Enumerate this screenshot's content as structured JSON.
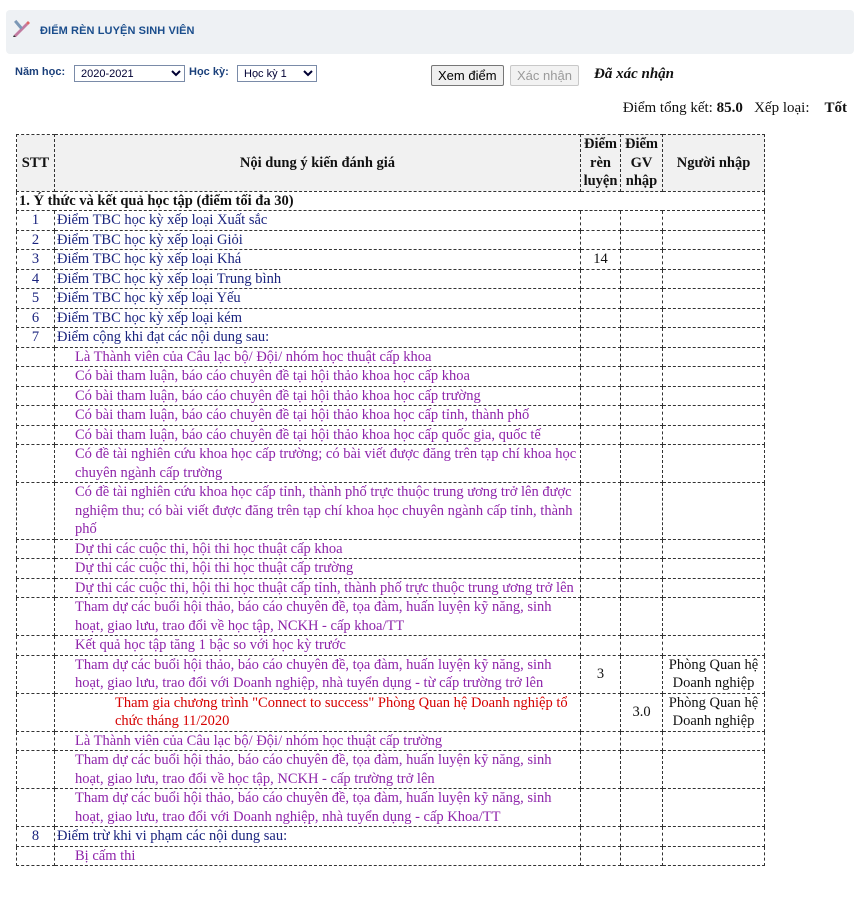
{
  "header": {
    "title": "ĐIỂM RÈN LUYỆN SINH VIÊN",
    "icon": "pencil-ruler-icon"
  },
  "filters": {
    "year_label": "Năm học:",
    "year_value": "2020-2021",
    "term_label": "Học kỳ:",
    "term_value": "Học kỳ 1",
    "view_button": "Xem điểm",
    "confirm_button": "Xác nhận",
    "status": "Đã xác nhận"
  },
  "summary": {
    "total_label": "Điểm tổng kết:",
    "total_value": "85.0",
    "rank_label": "Xếp loại:",
    "rank_value": "Tốt"
  },
  "table": {
    "headers": {
      "stt": "STT",
      "content": "Nội dung ý kiến đánh giá",
      "score": "Điểm rèn luyện",
      "gv_score": "Điểm GV nhập",
      "entered_by": "Người nhập"
    },
    "section1": "1. Ý thức và kết quả học tập (điểm tối đa 30)",
    "rows": [
      {
        "stt": "1",
        "text": "Điểm TBC học kỳ xếp loại Xuất sắc",
        "level": "main",
        "score": "",
        "gv": "",
        "who": ""
      },
      {
        "stt": "2",
        "text": "Điểm TBC học kỳ xếp loại Giỏi",
        "level": "main",
        "score": "",
        "gv": "",
        "who": ""
      },
      {
        "stt": "3",
        "text": "Điểm TBC học kỳ xếp loại Khá",
        "level": "main",
        "score": "14",
        "gv": "",
        "who": ""
      },
      {
        "stt": "4",
        "text": "Điểm TBC học kỳ xếp loại Trung bình",
        "level": "main",
        "score": "",
        "gv": "",
        "who": ""
      },
      {
        "stt": "5",
        "text": "Điểm TBC học kỳ xếp loại Yếu",
        "level": "main",
        "score": "",
        "gv": "",
        "who": ""
      },
      {
        "stt": "6",
        "text": "Điểm TBC học kỳ xếp loại kém",
        "level": "main",
        "score": "",
        "gv": "",
        "who": ""
      },
      {
        "stt": "7",
        "text": "Điểm cộng khi đạt các nội dung sau:",
        "level": "main",
        "score": "",
        "gv": "",
        "who": ""
      },
      {
        "stt": "",
        "text": "Là Thành viên của Câu lạc bộ/ Đội/ nhóm học thuật cấp khoa",
        "level": "sub",
        "score": "",
        "gv": "",
        "who": ""
      },
      {
        "stt": "",
        "text": "Có bài tham luận, báo cáo chuyên đề tại hội thảo khoa học cấp khoa",
        "level": "sub",
        "score": "",
        "gv": "",
        "who": ""
      },
      {
        "stt": "",
        "text": "Có bài tham luận, báo cáo chuyên đề tại hội thảo khoa học cấp trường",
        "level": "sub",
        "score": "",
        "gv": "",
        "who": ""
      },
      {
        "stt": "",
        "text": "Có bài tham luận, báo cáo chuyên đề tại hội thảo khoa học cấp tỉnh, thành phố",
        "level": "sub",
        "score": "",
        "gv": "",
        "who": ""
      },
      {
        "stt": "",
        "text": "Có bài tham luận, báo cáo chuyên đề tại hội thảo khoa học cấp quốc gia, quốc tế",
        "level": "sub",
        "score": "",
        "gv": "",
        "who": ""
      },
      {
        "stt": "",
        "text": "Có đề tài nghiên cứu khoa học cấp trường; có bài viết được đăng trên tạp chí khoa học chuyên ngành cấp trường",
        "level": "sub",
        "score": "",
        "gv": "",
        "who": ""
      },
      {
        "stt": "",
        "text": "Có đề tài nghiên cứu khoa học cấp tỉnh, thành phố trực thuộc trung ương trở lên được nghiệm thu; có bài viết được đăng trên tạp chí khoa học chuyên ngành cấp tỉnh, thành phố",
        "level": "sub",
        "score": "",
        "gv": "",
        "who": ""
      },
      {
        "stt": "",
        "text": "Dự thi các cuộc thi, hội thi học thuật cấp khoa",
        "level": "sub",
        "score": "",
        "gv": "",
        "who": ""
      },
      {
        "stt": "",
        "text": "Dự thi các cuộc thi, hội thi học thuật cấp trường",
        "level": "sub",
        "score": "",
        "gv": "",
        "who": ""
      },
      {
        "stt": "",
        "text": "Dự thi các cuộc thi, hội thi học thuật cấp tỉnh, thành phố trực thuộc trung ương trở lên",
        "level": "sub",
        "score": "",
        "gv": "",
        "who": ""
      },
      {
        "stt": "",
        "text": "Tham dự các buổi hội thảo, báo cáo chuyên đề, tọa đàm, huấn luyện kỹ năng, sinh hoạt, giao lưu, trao đổi về học tập, NCKH - cấp khoa/TT",
        "level": "sub",
        "score": "",
        "gv": "",
        "who": ""
      },
      {
        "stt": "",
        "text": "Kết quả học tập tăng 1 bậc so với học kỳ trước",
        "level": "sub",
        "score": "",
        "gv": "",
        "who": ""
      },
      {
        "stt": "",
        "text": "Tham dự các buổi hội thảo, báo cáo chuyên đề, tọa đàm, huấn luyện kỹ năng, sinh hoạt, giao lưu, trao đổi với Doanh nghiệp, nhà tuyển dụng - từ cấp trường trở lên",
        "level": "sub",
        "score": "3",
        "gv": "",
        "who": "Phòng Quan hệ Doanh nghiệp"
      },
      {
        "stt": "",
        "text": "Tham gia chương trình \"Connect to success\" Phòng Quan hệ Doanh nghiệp tổ chức tháng 11/2020",
        "level": "sub2",
        "score": "",
        "gv": "3.0",
        "who": "Phòng Quan hệ Doanh nghiệp"
      },
      {
        "stt": "",
        "text": "Là Thành viên của Câu lạc bộ/ Đội/ nhóm học thuật cấp trường",
        "level": "sub",
        "score": "",
        "gv": "",
        "who": ""
      },
      {
        "stt": "",
        "text": "Tham dự các buổi hội thảo, báo cáo chuyên đề, tọa đàm, huấn luyện kỹ năng, sinh hoạt, giao lưu, trao đổi về học tập, NCKH - cấp trường trở lên",
        "level": "sub",
        "score": "",
        "gv": "",
        "who": ""
      },
      {
        "stt": "",
        "text": "Tham dự các buổi hội thảo, báo cáo chuyên đề, tọa đàm, huấn luyện kỹ năng, sinh hoạt, giao lưu, trao đổi với Doanh nghiệp, nhà tuyển dụng - cấp Khoa/TT",
        "level": "sub",
        "score": "",
        "gv": "",
        "who": ""
      },
      {
        "stt": "8",
        "text": "Điểm trừ khi vi phạm các nội dung sau:",
        "level": "main",
        "score": "",
        "gv": "",
        "who": ""
      },
      {
        "stt": "",
        "text": "Bị cấm thi",
        "level": "sub",
        "score": "",
        "gv": "",
        "who": ""
      }
    ]
  }
}
